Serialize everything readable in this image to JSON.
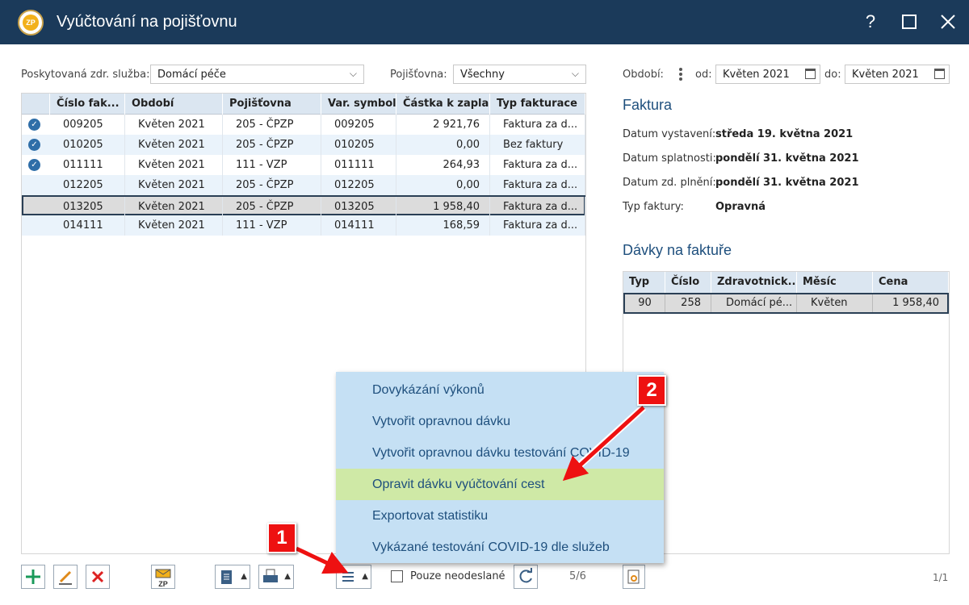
{
  "window": {
    "title": "Vyúčtování na pojišťovnu",
    "app_icon_text": "ZP"
  },
  "filters": {
    "service_label": "Poskytovaná zdr. služba:",
    "service_value": "Domácí péče",
    "insurer_label": "Pojišťovna:",
    "insurer_value": "Všechny",
    "period_label": "Období:",
    "from_label": "od:",
    "from_value": "Květen 2021",
    "to_label": "do:",
    "to_value": "Květen 2021"
  },
  "invoices": {
    "columns": [
      "Číslo fak...",
      "Období",
      "Pojišťovna",
      "Var. symbol",
      "Částka k zapla...",
      "Typ fakturace"
    ],
    "sort_indicator": "▲",
    "rows": [
      {
        "checked": true,
        "number": "009205",
        "period": "Květen 2021",
        "insurer": "205 - ČPZP",
        "vs": "009205",
        "amount": "2 921,76",
        "type": "Faktura za d..."
      },
      {
        "checked": true,
        "number": "010205",
        "period": "Květen 2021",
        "insurer": "205 - ČPZP",
        "vs": "010205",
        "amount": "0,00",
        "type": "Bez faktury"
      },
      {
        "checked": true,
        "number": "011111",
        "period": "Květen 2021",
        "insurer": "111 - VZP",
        "vs": "011111",
        "amount": "264,93",
        "type": "Faktura za d..."
      },
      {
        "checked": false,
        "number": "012205",
        "period": "Květen 2021",
        "insurer": "205 - ČPZP",
        "vs": "012205",
        "amount": "0,00",
        "type": "Faktura za d..."
      },
      {
        "checked": false,
        "number": "013205",
        "period": "Květen 2021",
        "insurer": "205 - ČPZP",
        "vs": "013205",
        "amount": "1 958,40",
        "type": "Faktura za d..."
      },
      {
        "checked": false,
        "number": "014111",
        "period": "Květen 2021",
        "insurer": "111 - VZP",
        "vs": "014111",
        "amount": "168,59",
        "type": "Faktura za d..."
      }
    ]
  },
  "invoice_detail": {
    "title": "Faktura",
    "issue_label": "Datum vystavení:",
    "issue_value": "středa 19. května 2021",
    "due_label": "Datum splatnosti:",
    "due_value": "pondělí 31. května 2021",
    "supply_label": "Datum zd. plnění:",
    "supply_value": "pondělí 31. května 2021",
    "type_label": "Typ faktury:",
    "type_value": "Opravná"
  },
  "batches": {
    "title": "Dávky na faktuře",
    "columns": [
      "Typ",
      "Číslo",
      "Zdravotnick...",
      "Měsíc",
      "Cena"
    ],
    "row": {
      "type": "90",
      "number": "258",
      "facility": "Domácí pé...",
      "month": "Květen",
      "price": "1 958,40"
    }
  },
  "context_menu": {
    "items": [
      "Dovykázání výkonů",
      "Vytvořit opravnou dávku",
      "Vytvořit opravnou dávku testování COVID-19",
      "Opravit dávku vyúčtování cest",
      "Exportovat statistiku",
      "Vykázané testování COVID-19 dle služeb"
    ],
    "highlighted_index": 3
  },
  "toolbar": {
    "only_unsent_label": "Pouze neodeslané",
    "record_counter": "5/6",
    "page_counter": "1/1",
    "zp_label": "ZP"
  },
  "annotations": {
    "badge1": "1",
    "badge2": "2"
  },
  "colors": {
    "titlebar": "#1b3a5a",
    "accent": "#1e4f7d",
    "menu_bg": "#c5e0f4",
    "menu_highlight": "#cfe9a6",
    "annotation": "#e11111"
  }
}
